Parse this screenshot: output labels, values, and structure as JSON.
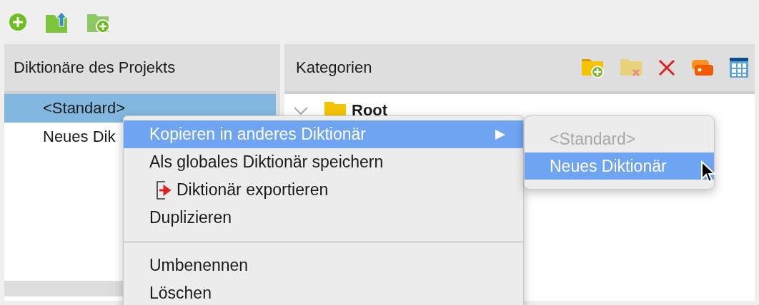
{
  "toolbar": [
    {
      "kind": "add"
    },
    {
      "kind": "folder-up"
    },
    {
      "kind": "folder-add"
    }
  ],
  "left_panel": {
    "title": "Diktionäre des Projekts",
    "items": [
      {
        "label": "<Standard>",
        "selected": true
      },
      {
        "label": "Neues Dik",
        "selected": false
      }
    ]
  },
  "right_panel": {
    "title": "Kategorien",
    "tools": [
      {
        "kind": "folder-add"
      },
      {
        "kind": "folder-remove"
      },
      {
        "kind": "delete"
      },
      {
        "kind": "tag"
      },
      {
        "kind": "table"
      }
    ],
    "tree": [
      {
        "label": "Root",
        "expanded": true
      }
    ]
  },
  "context_menu": [
    {
      "kind": "item",
      "label": "Kopieren in anderes Diktionär",
      "selected": true,
      "submenu": true,
      "icon": false
    },
    {
      "kind": "item",
      "label": "Als globales Diktionär speichern",
      "selected": false,
      "submenu": false,
      "icon": false
    },
    {
      "kind": "item",
      "label": "Diktionär exportieren",
      "selected": false,
      "submenu": false,
      "icon": true
    },
    {
      "kind": "item",
      "label": "Duplizieren",
      "selected": false,
      "submenu": false,
      "icon": false
    },
    {
      "kind": "separator"
    },
    {
      "kind": "item",
      "label": "Umbenennen",
      "selected": false,
      "submenu": false,
      "icon": false
    },
    {
      "kind": "item",
      "label": "Löschen",
      "selected": false,
      "submenu": false,
      "icon": false
    }
  ],
  "submenu": [
    {
      "label": "<Standard>",
      "disabled": true,
      "selected": false
    },
    {
      "label": "Neues Diktionär",
      "disabled": false,
      "selected": true
    }
  ]
}
